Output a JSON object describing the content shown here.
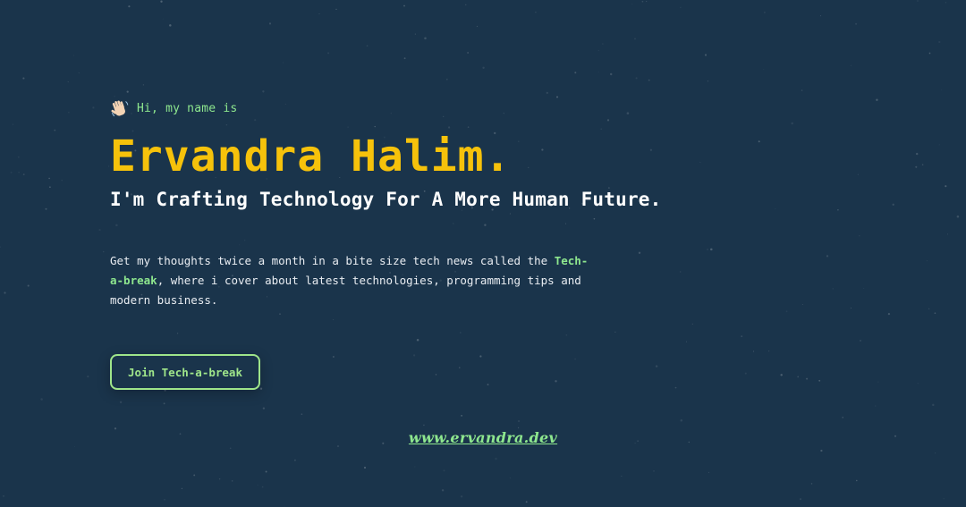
{
  "hero": {
    "wave_icon": "waving-hand-icon",
    "greeting": "Hi, my name is",
    "name": "Ervandra Halim.",
    "tagline": "I'm Crafting Technology For A More Human Future.",
    "description": {
      "part1": "Get my thoughts twice a month in a bite size tech news called the",
      "highlight": "Tech-a-break",
      "part2": ", where i cover about latest technologies, programming tips and modern business."
    },
    "cta_label": "Join Tech-a-break"
  },
  "footer": {
    "site_link": "www.ervandra.dev"
  },
  "colors": {
    "background": "#1a344b",
    "name": "#f6c20b",
    "accent": "#8ee78e",
    "text": "#ffffff"
  }
}
